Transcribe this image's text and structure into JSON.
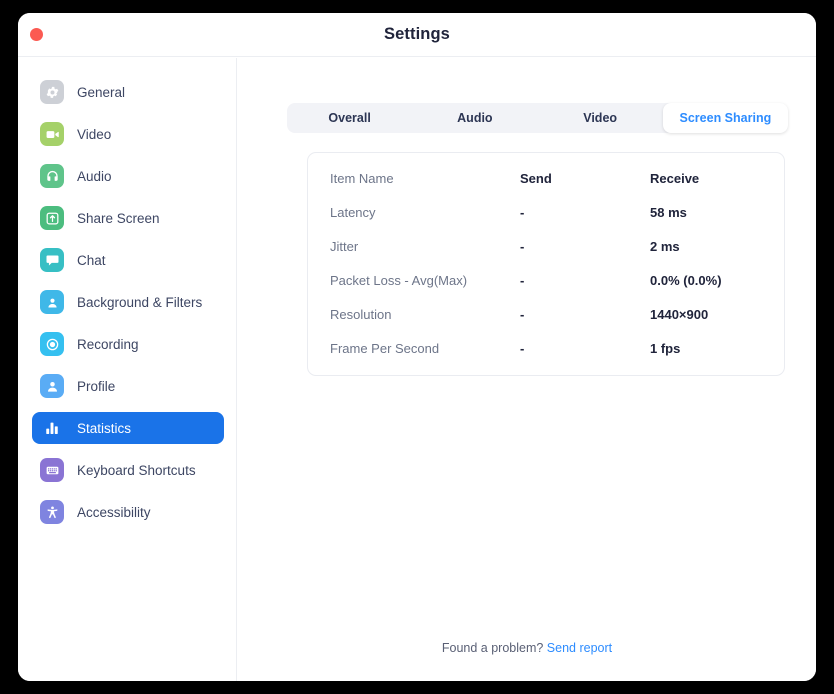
{
  "window": {
    "title": "Settings",
    "close_icon": "close-traffic-light",
    "accent_color": "#2d8cff",
    "active_nav_color": "#1a73e8"
  },
  "sidebar": {
    "items": [
      {
        "label": "General",
        "icon": "gear-icon",
        "color": "#cdd0d6",
        "active": false
      },
      {
        "label": "Video",
        "icon": "video-camera-icon",
        "color": "#a5d169",
        "active": false
      },
      {
        "label": "Audio",
        "icon": "headphones-icon",
        "color": "#5fc48a",
        "active": false
      },
      {
        "label": "Share Screen",
        "icon": "share-screen-icon",
        "color": "#4cbd7f",
        "active": false
      },
      {
        "label": "Chat",
        "icon": "chat-bubble-icon",
        "color": "#37bfc4",
        "active": false
      },
      {
        "label": "Background & Filters",
        "icon": "background-filters-icon",
        "color": "#3fb8e8",
        "active": false
      },
      {
        "label": "Recording",
        "icon": "recording-icon",
        "color": "#35c0f0",
        "active": false
      },
      {
        "label": "Profile",
        "icon": "profile-icon",
        "color": "#5aacf5",
        "active": false
      },
      {
        "label": "Statistics",
        "icon": "statistics-icon",
        "color": "#1a73e8",
        "active": true
      },
      {
        "label": "Keyboard Shortcuts",
        "icon": "keyboard-icon",
        "color": "#8a74d4",
        "active": false
      },
      {
        "label": "Accessibility",
        "icon": "accessibility-icon",
        "color": "#7f84e0",
        "active": false
      }
    ]
  },
  "main": {
    "tabs": [
      {
        "label": "Overall",
        "active": false
      },
      {
        "label": "Audio",
        "active": false
      },
      {
        "label": "Video",
        "active": false
      },
      {
        "label": "Screen Sharing",
        "active": true
      }
    ],
    "table": {
      "headers": {
        "name": "Item Name",
        "send": "Send",
        "receive": "Receive"
      },
      "rows": [
        {
          "name": "Latency",
          "send": "-",
          "receive": "58 ms"
        },
        {
          "name": "Jitter",
          "send": "-",
          "receive": "2 ms"
        },
        {
          "name": "Packet Loss - Avg(Max)",
          "send": "-",
          "receive": "0.0% (0.0%)"
        },
        {
          "name": "Resolution",
          "send": "-",
          "receive": "1440×900"
        },
        {
          "name": "Frame Per Second",
          "send": "-",
          "receive": "1 fps"
        }
      ]
    },
    "footer": {
      "prompt": "Found a problem?",
      "link": "Send report"
    }
  }
}
